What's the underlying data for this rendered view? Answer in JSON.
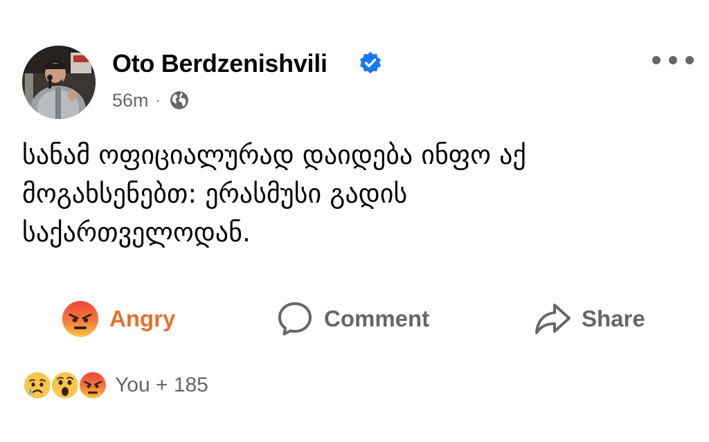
{
  "post": {
    "author": {
      "name": "Oto Berdzenishvili",
      "verified": true,
      "avatar_icon": "profile-photo"
    },
    "meta": {
      "time": "56m",
      "separator": "·",
      "audience_icon": "globe-icon"
    },
    "text": {
      "line1": "სანამ ოფიციალურად დაიდება ინფო აქ",
      "line2": "მოგახსენებთ: ერასმუსი გადის",
      "line3": "საქართველოდან."
    },
    "actions": {
      "reaction_label": "Angry",
      "reaction_icon": "angry-emoji",
      "comment_label": "Comment",
      "share_label": "Share"
    },
    "reactions_summary": {
      "icons": [
        "sad-emoji",
        "wow-emoji",
        "angry-emoji"
      ],
      "count_text": "You + 185"
    }
  },
  "colors": {
    "text_primary": "#050505",
    "text_secondary": "#65676b",
    "verified_blue": "#1877f2",
    "angry_label": "#e4722c"
  }
}
